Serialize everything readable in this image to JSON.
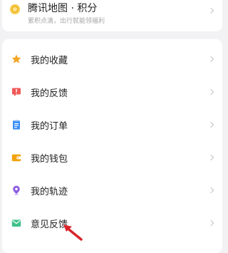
{
  "points": {
    "title": "腾讯地图 · 积分",
    "subtitle": "累积点滴，出行就能领福利",
    "icon": "coin-icon"
  },
  "menu": {
    "items": [
      {
        "label": "我的收藏",
        "icon": "star-icon",
        "color": "#f5a623"
      },
      {
        "label": "我的反馈",
        "icon": "feedback-alert-icon",
        "color": "#ee5a57"
      },
      {
        "label": "我的订单",
        "icon": "order-clipboard-icon",
        "color": "#3a8ef6"
      },
      {
        "label": "我的钱包",
        "icon": "wallet-icon",
        "color": "#f2a30f"
      },
      {
        "label": "我的轨迹",
        "icon": "location-pin-icon",
        "color": "#8c5ce0"
      },
      {
        "label": "意见反馈",
        "icon": "mail-icon",
        "color": "#3ec28a"
      }
    ]
  },
  "annotation": {
    "icon": "red-arrow-icon",
    "color": "#d9232a"
  }
}
